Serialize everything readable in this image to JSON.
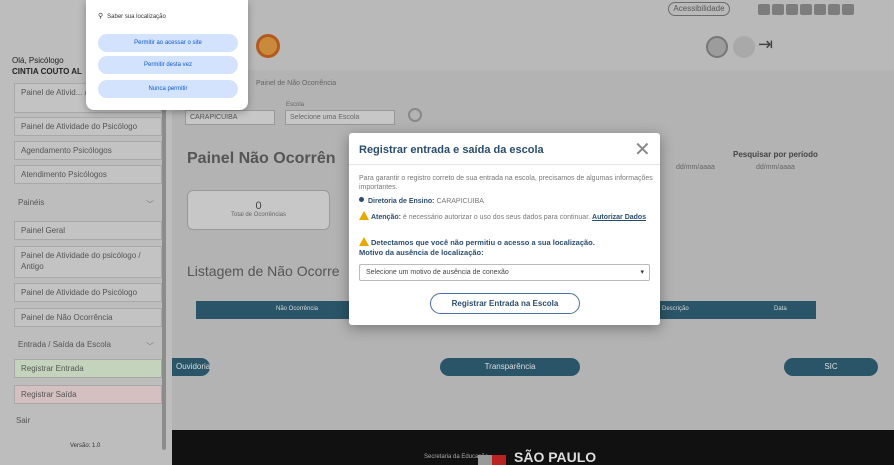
{
  "header": {
    "digital_label": "Acessibilidade",
    "accessibility_icons": [
      "a-icon",
      "b-icon",
      "c-icon",
      "d-icon",
      "e-icon",
      "f-icon",
      "g-icon"
    ]
  },
  "sidebar": {
    "greeting": "Olá, Psicólogo",
    "user_name": "CINTIA COUTO AL",
    "items": [
      {
        "label": "Painel de Ativid... / Antigo"
      },
      {
        "label": "Painel de Atividade do Psicólogo"
      },
      {
        "label": "Agendamento Psicólogos"
      },
      {
        "label": "Atendimento Psicólogos"
      },
      {
        "label": "Painéis"
      },
      {
        "label": "Painel Geral"
      },
      {
        "label": "Painel de Atividade do psicólogo / Antigo"
      },
      {
        "label": "Painel de Atividade do Psicólogo"
      },
      {
        "label": "Painel de Não Ocorrência"
      },
      {
        "label": "Entrada / Saída da Escola"
      },
      {
        "label": "Registrar Entrada"
      },
      {
        "label": "Registrar Saída"
      },
      {
        "label": "Sair"
      }
    ],
    "version": "Versão: 1.0"
  },
  "location_popup": {
    "title": "Saber sua localização",
    "allow_on_visit": "Permitir ao acessar o site",
    "allow_once": "Permitir desta vez",
    "never_allow": "Nunca permitir"
  },
  "main": {
    "breadcrumb": "Painel de Não Ocorrência",
    "escola_label": "Escola",
    "diretoria_value": "CARAPICUIBA",
    "escola_placeholder": "Selecione uma Escola",
    "page_title": "Painel Não Ocorrên",
    "period_label": "Pesquisar por período",
    "date_from": "dd/mm/aaaa",
    "date_to": "dd/mm/aaaa",
    "count_value": "0",
    "count_label": "Total de Ocorrências",
    "list_title": "Listagem de Não Ocorre",
    "table_headers": [
      "Não Ocorrência",
      "Descrição",
      "Data"
    ]
  },
  "footer_links": {
    "ouvidoria": "Ouvidoria",
    "transparencia": "Transparência",
    "sic": "SIC"
  },
  "footer": {
    "secretaria": "Secretaria da Educação",
    "state": "SÃO PAULO"
  },
  "modal": {
    "title": "Registrar entrada e saída da escola",
    "close_glyph": "✕",
    "intro": "Para garantir o registro correto de sua entrada na escola, precisamos de algumas informações importantes.",
    "diretoria_label": "Diretoria de Ensino:",
    "diretoria_value": "CARAPICUIBA",
    "attention_label": "Atenção:",
    "attention_text": "é necessário autorizar o uso dos seus dados para continuar.",
    "authorize_link": "Autorizar Dados",
    "location_warning": "Detectamos que você não permitiu o acesso a sua localização.",
    "reason_label": "Motivo da ausência de localização:",
    "select_value": "Selecione um motivo de ausência de conexão",
    "submit_label": "Registrar Entrada na Escola"
  }
}
